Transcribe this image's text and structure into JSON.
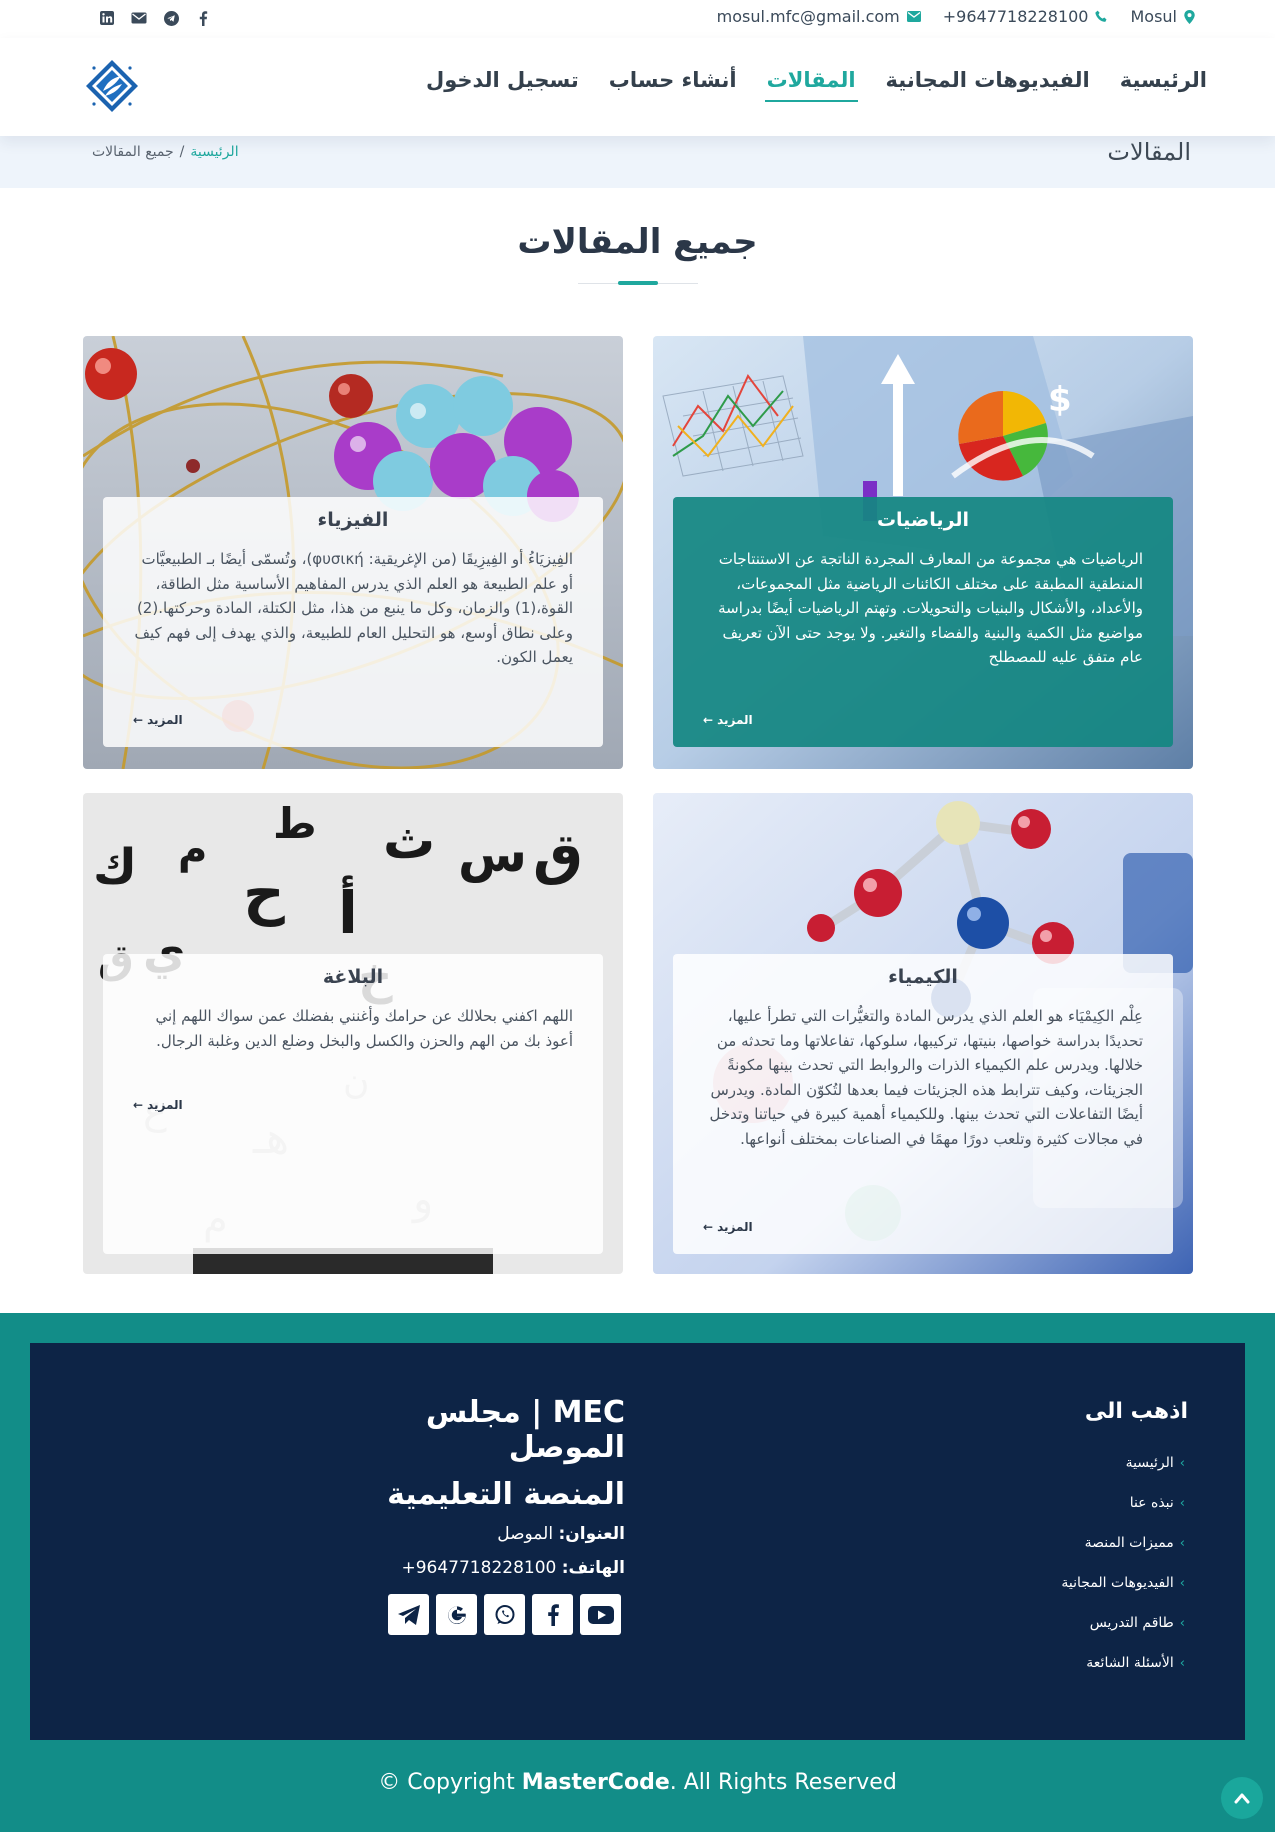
{
  "topbar": {
    "location": "Mosul",
    "phone": "+9647718228100",
    "email": "mosul.mfc@gmail.com",
    "social_icons": [
      "linkedin-icon",
      "mail-icon",
      "telegram-icon",
      "facebook-icon"
    ]
  },
  "nav": {
    "items": [
      {
        "label": "الرئيسية",
        "active": false
      },
      {
        "label": "الفيديوهات المجانية",
        "active": false
      },
      {
        "label": "المقالات",
        "active": true
      },
      {
        "label": "أنشاء حساب",
        "active": false
      },
      {
        "label": "تسجيل الدخول",
        "active": false
      }
    ]
  },
  "breadcrumb": {
    "page_title": "المقالات",
    "home": "الرئيسية",
    "separator": "/",
    "current": "جميع المقالات"
  },
  "section": {
    "title": "جميع المقالات"
  },
  "articles": [
    {
      "title": "الرياضيات",
      "text": "الرياضيات هي مجموعة من المعارف المجردة الناتجة عن الاستنتاجات المنطقية المطبقة على مختلف الكائنات الرياضية مثل المجموعات، والأعداد، والأشكال والبنيات والتحويلات. وتهتم الرياضيات أيضًا بدراسة مواضيع مثل الكمية والبنية والفضاء والتغير. ولا يوجد حتى الآن تعريف عام متفق عليه للمصطلح",
      "more": "المزيد"
    },
    {
      "title": "الفيزياء",
      "text": "الفِيزيَاءُ أو الفِيزِيقَا (من الإغريقية: φυσική)، وتُسمّى أيضًا بـ الطبيعيَّات أو علم الطبيعة هو العلم الذي يدرس المفاهيم الأساسية مثل الطاقة، القوة،(1) والزمان، وكل ما ينبع من هذا، مثل الكتلة، المادة وحركتها.(2) وعلى نطاق أوسع، هو التحليل العام للطبيعة، والذي يهدف إلى فهم كيف يعمل الكون.",
      "more": "المزيد"
    },
    {
      "title": "الكيمياء",
      "text": "عِلْم الكِيمْيَاء هو العلم الذي يدرس المادة والتغيُّرات التي تطرأ عليها، تحديدًا بدراسة خواصها، بنيتها، تركيبها، سلوكها، تفاعلاتها وما تحدثه من خلالها. ويدرس علم الكيمياء الذرات والروابط التي تحدث بينها مكونةً الجزيئات، وكيف تترابط هذه الجزيئات فيما بعدها لتُكوّن المادة. ويدرس أيضًا التفاعلات التي تحدث بينها. وللكيمياء أهمية كبيرة في حياتنا وتدخل في مجالات كثيرة وتلعب دورًا مهمًا في الصناعات بمختلف أنواعها.",
      "more": "المزيد"
    },
    {
      "title": "البلاغة",
      "text": "اللهم اكفني بحلالك عن حرامك وأغنني بفضلك عمن سواك اللهم إني أعوذ بك من الهم والحزن والكسل والبخل وضلع الدين وغلبة الرجال.",
      "more": "المزيد"
    }
  ],
  "footer": {
    "links_title": "اذهب الى",
    "links": [
      "الرئيسية",
      "نبذه عنا",
      "مميزات المنصة",
      "الفيديوهات المجانية",
      "طاقم التدريس",
      "الأسئلة الشائعة"
    ],
    "brand_line1": "MEC | مجلس الموصل",
    "brand_line2": "المنصة التعليمية",
    "address_label": "العنوان:",
    "address": "الموصل",
    "phone_label": "الهاتف:",
    "phone": "+9647718228100",
    "social_icons": [
      "telegram-icon",
      "google-icon",
      "whatsapp-icon",
      "facebook-icon",
      "youtube-icon"
    ],
    "copyright_prefix": "© Copyright ",
    "copyright_brand": "MasterCode",
    "copyright_suffix": ". All Rights Reserved"
  },
  "colors": {
    "accent": "#1fa89e",
    "footer_outer": "#128d88",
    "footer_inner": "#0d2446",
    "teal_card": "#148782"
  }
}
